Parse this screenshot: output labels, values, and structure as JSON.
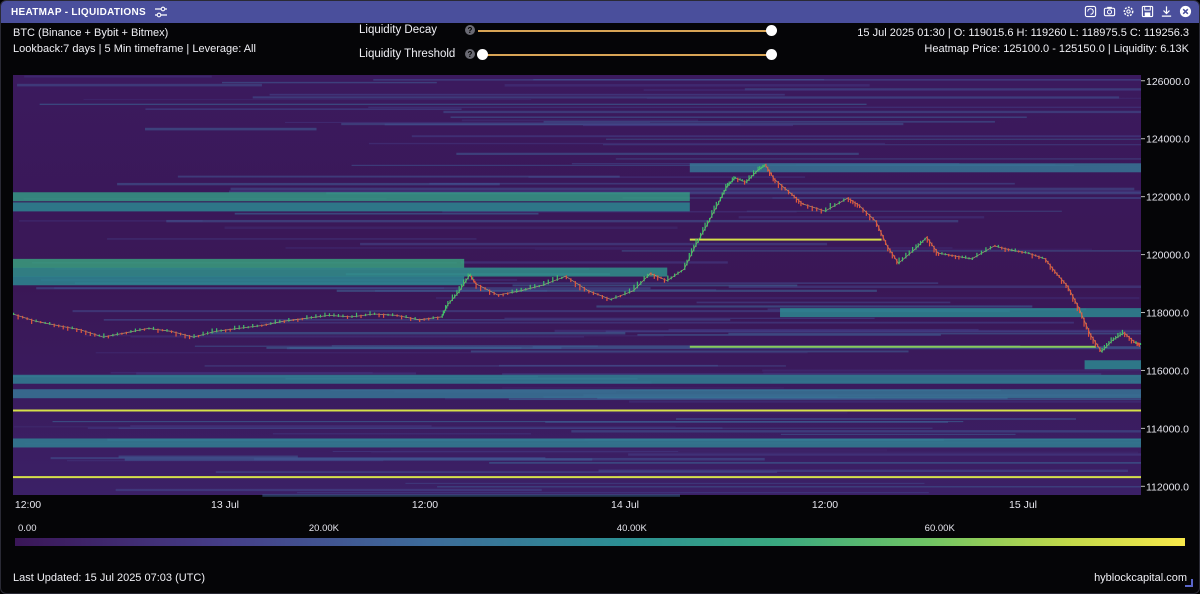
{
  "window": {
    "title": "HEATMAP - LIQUIDATIONS",
    "settings_icon": "sliders-icon",
    "buttons": [
      "refresh-icon",
      "camera-icon",
      "gear-icon",
      "save-icon",
      "download-icon",
      "close-icon"
    ]
  },
  "info": {
    "exchanges": "BTC (Binance + Bybit + Bitmex)",
    "lookback": "Lookback:7 days | 5 Min timeframe | Leverage: All",
    "ohlc": "15 Jul 2025 01:30 | O: 119015.6 H: 119260 L: 118975.5 C: 119256.3",
    "heatmap_price": "Heatmap Price: 125100.0 - 125150.0 | Liquidity: 6.13K"
  },
  "controls": {
    "decay_label": "Liquidity Decay",
    "threshold_label": "Liquidity Threshold",
    "decay_value": 1.0,
    "threshold_value": 1.0
  },
  "chart_data": {
    "type": "heatmap",
    "title": "",
    "xlabel": "",
    "ylabel": "",
    "x_ticks": [
      "12:00",
      "13 Jul",
      "12:00",
      "14 Jul",
      "12:00",
      "15 Jul"
    ],
    "y_ticks": [
      "126000.0",
      "124000.0",
      "122000.0",
      "120000.0",
      "118000.0",
      "116000.0",
      "114000.0",
      "112000.0"
    ],
    "ylim": [
      111700,
      126200
    ],
    "price_series": {
      "name": "BTC",
      "points": [
        [
          0,
          117950
        ],
        [
          0.02,
          117700
        ],
        [
          0.04,
          117550
        ],
        [
          0.06,
          117400
        ],
        [
          0.08,
          117150
        ],
        [
          0.1,
          117300
        ],
        [
          0.12,
          117450
        ],
        [
          0.14,
          117350
        ],
        [
          0.16,
          117150
        ],
        [
          0.18,
          117350
        ],
        [
          0.2,
          117450
        ],
        [
          0.22,
          117550
        ],
        [
          0.24,
          117700
        ],
        [
          0.26,
          117800
        ],
        [
          0.28,
          117900
        ],
        [
          0.3,
          117850
        ],
        [
          0.32,
          117950
        ],
        [
          0.34,
          117900
        ],
        [
          0.36,
          117750
        ],
        [
          0.38,
          117850
        ],
        [
          0.385,
          118250
        ],
        [
          0.395,
          118700
        ],
        [
          0.405,
          119300
        ],
        [
          0.41,
          119000
        ],
        [
          0.43,
          118600
        ],
        [
          0.45,
          118750
        ],
        [
          0.47,
          118950
        ],
        [
          0.49,
          119250
        ],
        [
          0.51,
          118750
        ],
        [
          0.53,
          118450
        ],
        [
          0.55,
          118750
        ],
        [
          0.565,
          119350
        ],
        [
          0.58,
          119100
        ],
        [
          0.595,
          119500
        ],
        [
          0.605,
          120300
        ],
        [
          0.615,
          121000
        ],
        [
          0.625,
          121750
        ],
        [
          0.633,
          122350
        ],
        [
          0.64,
          122650
        ],
        [
          0.65,
          122500
        ],
        [
          0.66,
          122900
        ],
        [
          0.667,
          123100
        ],
        [
          0.675,
          122600
        ],
        [
          0.69,
          122100
        ],
        [
          0.7,
          121750
        ],
        [
          0.72,
          121500
        ],
        [
          0.74,
          121950
        ],
        [
          0.75,
          121700
        ],
        [
          0.765,
          121150
        ],
        [
          0.775,
          120300
        ],
        [
          0.785,
          119700
        ],
        [
          0.8,
          120200
        ],
        [
          0.81,
          120600
        ],
        [
          0.82,
          120050
        ],
        [
          0.835,
          119950
        ],
        [
          0.85,
          119850
        ],
        [
          0.87,
          120300
        ],
        [
          0.885,
          120150
        ],
        [
          0.9,
          120050
        ],
        [
          0.915,
          119850
        ],
        [
          0.925,
          119350
        ],
        [
          0.935,
          118900
        ],
        [
          0.945,
          118150
        ],
        [
          0.955,
          117250
        ],
        [
          0.965,
          116650
        ],
        [
          0.975,
          117050
        ],
        [
          0.985,
          117300
        ],
        [
          0.995,
          116950
        ],
        [
          1.0,
          116900
        ]
      ]
    },
    "scale": {
      "labels": [
        "0.00",
        "20.00K",
        "40.00K",
        "60.00K"
      ],
      "values": [
        0,
        20000,
        40000,
        60000
      ],
      "max": 76000
    },
    "liquidity_bands": [
      {
        "price": 123100,
        "start": 0.6,
        "end": 1.0,
        "intensity": 0.45
      },
      {
        "price": 122100,
        "start": 0.0,
        "end": 0.6,
        "intensity": 0.65
      },
      {
        "price": 121750,
        "start": 0.0,
        "end": 0.6,
        "intensity": 0.55
      },
      {
        "price": 120500,
        "start": 0.6,
        "end": 0.77,
        "intensity": 0.95
      },
      {
        "price": 119800,
        "start": 0.0,
        "end": 0.4,
        "intensity": 0.7
      },
      {
        "price": 119500,
        "start": 0.0,
        "end": 0.58,
        "intensity": 0.6
      },
      {
        "price": 119200,
        "start": 0.0,
        "end": 0.4,
        "intensity": 0.55
      },
      {
        "price": 118100,
        "start": 0.68,
        "end": 1.0,
        "intensity": 0.55
      },
      {
        "price": 116800,
        "start": 0.6,
        "end": 0.96,
        "intensity": 0.85
      },
      {
        "price": 116300,
        "start": 0.95,
        "end": 1.0,
        "intensity": 0.55
      },
      {
        "price": 115800,
        "start": 0.0,
        "end": 1.0,
        "intensity": 0.5
      },
      {
        "price": 115300,
        "start": 0.0,
        "end": 1.0,
        "intensity": 0.45
      },
      {
        "price": 114600,
        "start": 0.0,
        "end": 1.0,
        "intensity": 0.95
      },
      {
        "price": 113600,
        "start": 0.0,
        "end": 1.0,
        "intensity": 0.5
      },
      {
        "price": 112300,
        "start": 0.0,
        "end": 1.0,
        "intensity": 0.95
      }
    ]
  },
  "footer": {
    "last_updated": "Last Updated: 15 Jul 2025 07:03 (UTC)",
    "brand": "hyblockcapital.com"
  },
  "colors": {
    "titlebar": "#4a4f9c",
    "background": "#3a1657",
    "candle_up": "#3fbf6a",
    "candle_down": "#e0553c",
    "slider": "#d8a455"
  }
}
